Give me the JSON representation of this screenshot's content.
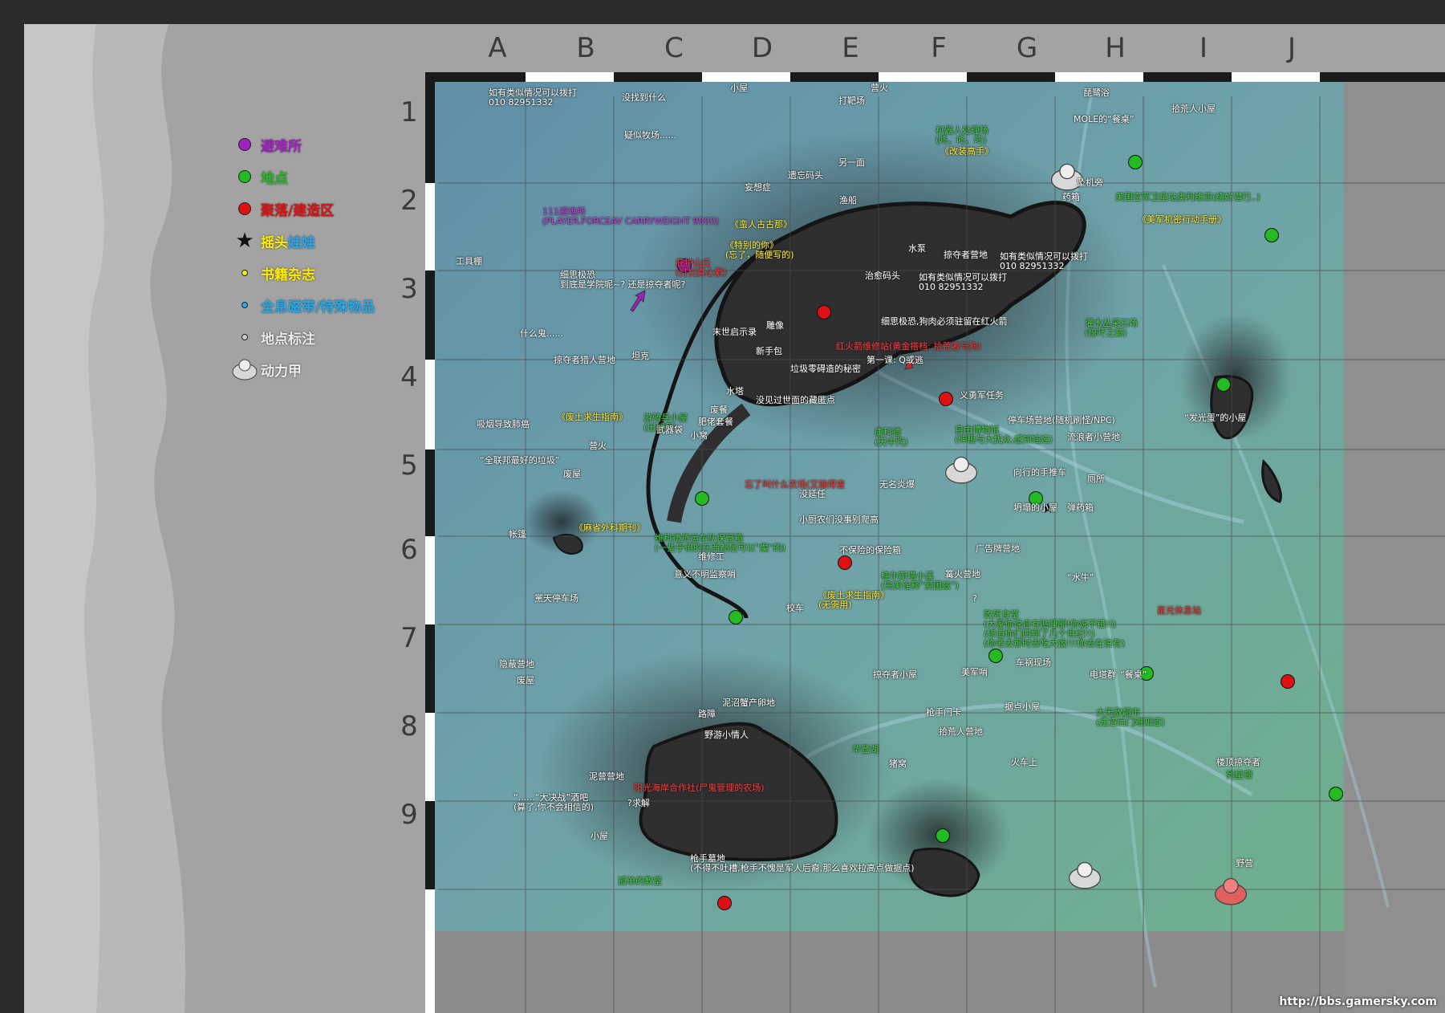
{
  "legend": [
    {
      "icon": "purple-dot-icon",
      "color": "#a020c0",
      "label": "避难所"
    },
    {
      "icon": "green-dot-icon",
      "color": "#22bb22",
      "label": "地点"
    },
    {
      "icon": "red-dot-icon",
      "color": "#dd1111",
      "label": "聚落/建造区"
    },
    {
      "icon": "star-icon",
      "color": "#111111",
      "label": "摇头娃娃",
      "label_part1": "摇头",
      "label_part2": "娃娃"
    },
    {
      "icon": "yellow-dot-icon",
      "color": "#ffee00",
      "label": "书籍杂志"
    },
    {
      "icon": "cyan-dot-icon",
      "color": "#22aaee",
      "label": "全息磁带/特殊物品"
    },
    {
      "icon": "gray-dot-icon",
      "color": "#cccccc",
      "label": "地点标注"
    },
    {
      "icon": "power-armor-icon",
      "color": "#dddddd",
      "label": "动力甲"
    }
  ],
  "grid": {
    "columns": [
      "A",
      "B",
      "C",
      "D",
      "E",
      "F",
      "G",
      "H",
      "I",
      "J"
    ],
    "rows": [
      "1",
      "2",
      "3",
      "4",
      "5",
      "6",
      "7",
      "8",
      "9"
    ]
  },
  "labels": {
    "l1": "如有类似情况可以拨打\n010 82951332",
    "l2": "没找到什么",
    "l3": "小屋",
    "l4": "营火",
    "l5": "打靶场",
    "l6": "琵鹭浴",
    "l7": "拾荒人小屋",
    "l8": "MOLE的“餐桌”",
    "l9": "疑似牧场......",
    "l10": "机器人处理场\n(咚、咚、咚)",
    "l11": "《改装高手》",
    "l12": "坠机旁",
    "l13": "遗忘码头",
    "l14": "另一面",
    "l15": "妄想症",
    "l16": "渔船",
    "l17": "药箱",
    "l18": "美国空军卫星站奥利维亚(绕好潜行..)",
    "l19": "《美军机密行动手册》",
    "l20": "111避难所\n(PLAYER.FORCEAV CARRYWEIGHT 9000)",
    "l21": "《蛮人古古那》",
    "l22": "《特别的你》\n(忘了，随便写的)",
    "l23": "庇护山丘\n(打扫真心累)",
    "l24": "工具棚",
    "l25": "细思极恐\n到底是学院呢~? 还是掠夺者呢?",
    "l26": "水泵",
    "l27": "掠夺者营地",
    "l28": "如有类似情况可以拨打\n010 82951332",
    "l29": "如有类似情况可以拨打\n010 82951332",
    "l30": "治愈码头",
    "l31": "细思极恐,狗肉必须驻留在红火箭",
    "l32": "灌木丛采石场\n(惊吓之巅)",
    "l33": "什么鬼......",
    "l34": "末世启示录",
    "l35": "雕像",
    "l36": "红火箭维修站(黄金搭档: 拾荒者与狗)",
    "l37": "新手包",
    "l38": "坦克",
    "l39": "掠夺者猎人营地",
    "l40": "垃圾零碍造的秘密",
    "l41": "第一课: Q或逃",
    "l42": "水塔",
    "l43": "没见过世面的藏匿点",
    "l44": "义勇军任务",
    "l45": "吸烟导致肺癌",
    "l46": "《废土求生指南》",
    "l47": "游骑兵小屋\n(出城我)",
    "l48": "武器袋",
    "l49": "废餐",
    "l50": "肥佬套餐",
    "l51": "小窝",
    "l52": "营火",
    "l53": "“全联邦最好的垃圾”",
    "l54": "停车场营地(随机刷怪/NPC)",
    "l55": "“发光蛋”的小屋",
    "l56": "康科德\n(天中咒)",
    "l57": "自由博物馆\n(伸根与大扰众,感知娃娃)",
    "l58": "流浪者小营地",
    "l59": "废屋",
    "l60": "忘了叫什么农场(又输得查",
    "l61": "没延任",
    "l62": "无名炎爆",
    "l63": "向行的手推车",
    "l64": "厕所",
    "l65": "坍塌的小屋",
    "l66": "弹药箱",
    "l67": "帐篷",
    "l68": "《麻省外科期刊》",
    "l69": "维科德货运车队保管箱\n(一些乎倒的东西都是可以“魔”的)",
    "l70": "小厨农们没事别爬高",
    "l71": "不保险的保险箱",
    "l72": "广告牌营地",
    "l73": "维修工",
    "l74": "意义不明监察哨",
    "l75": "桂尔斯塔小溪\n(完美诠释“爱国兹”)",
    "l76": "篝火营地",
    "l77": "“水牛”",
    "l78": "星光休息站",
    "l79": "黨天停车场",
    "l80": "《废土求生指南》\n(无需用)",
    "l81": "校车",
    "l82": "致死食堂\n(大家你说自有贴睡邵!你说不错!!)\n(修道你们四到了几个世纪!!)\n(你老去那时去吃大饭!!!你去在说有)",
    "l83": "隐蔽营地",
    "l84": "废屋",
    "l85": "车祸现场",
    "l86": "掠夺者小屋",
    "l87": "美军哨",
    "l88": "电塔群",
    "l89": "“餐桌”",
    "l90": "泥沼蟹产卵地",
    "l91": "路障",
    "l92": "野游小情人",
    "l93": "枪手门卡",
    "l94": "据点小屋",
    "l95": "拾荒人营地",
    "l96": "大无敌超市\n(建造后门难知道)",
    "l97": "华登湖",
    "l98": "火车上",
    "l99": "楼顶掠夺者",
    "l100": "列星顿",
    "l101": "猪窝",
    "l102": "泥营营地",
    "l103": "阳光海岸合作社(尸鬼管理的农场)",
    "l104": "“......“大决战”酒吧\n(算了,你不会相信的)",
    "l105": "?求解",
    "l106": "小屋",
    "l107": "枪手墓地\n(不得不吐槽,枪手不愧是军人后裔,那么喜欢拉高点做据点)",
    "l108": "孤单的教堂",
    "l109": "野营",
    "l110": "?"
  },
  "watermark": "http://bbs.gamersky.com"
}
